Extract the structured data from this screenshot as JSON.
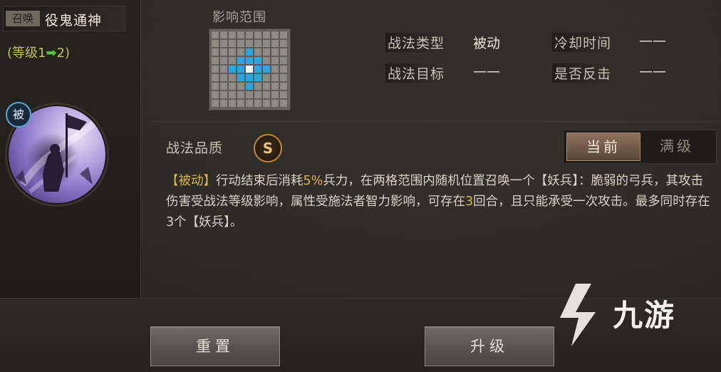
{
  "skill": {
    "type_tag": "召唤",
    "name": "役鬼通神",
    "level_prefix": "(等级1",
    "level_arrow": "➡",
    "level_suffix": "2)",
    "passive_badge": "被"
  },
  "range": {
    "title": "影响范围",
    "grid_size": 9,
    "highlight_cells": [
      [
        2,
        4
      ],
      [
        3,
        3
      ],
      [
        3,
        4
      ],
      [
        3,
        5
      ],
      [
        4,
        2
      ],
      [
        4,
        3
      ],
      [
        4,
        5
      ],
      [
        4,
        6
      ],
      [
        5,
        3
      ],
      [
        5,
        4
      ],
      [
        5,
        5
      ],
      [
        6,
        4
      ]
    ],
    "center_cell": [
      4,
      4
    ],
    "highlight_color": "#2aa7e0",
    "center_color": "#ffffff"
  },
  "info": {
    "type_label": "战法类型",
    "type_value": "被动",
    "cooldown_label": "冷却时间",
    "cooldown_value": "——",
    "target_label": "战法目标",
    "target_value": "——",
    "counter_label": "是否反击",
    "counter_value": "——"
  },
  "quality": {
    "label": "战法品质",
    "grade": "S"
  },
  "toggle": {
    "current": "当前",
    "max": "满级"
  },
  "description": {
    "p1": "【被动】",
    "p2": "行动结束后消耗",
    "p3": "5%",
    "p4": "兵力，在两格范围内随机位置召唤一个【妖兵】：脆弱的弓兵，其攻击伤害受战法等级影响，属性受施法者智力影响，可存在",
    "p5": "3",
    "p6": "回合，且只能承受一次攻击。最多同时存在3个【妖兵】。"
  },
  "buttons": {
    "reset": "重置",
    "upgrade": "升级"
  },
  "watermark": {
    "text": "九游"
  }
}
